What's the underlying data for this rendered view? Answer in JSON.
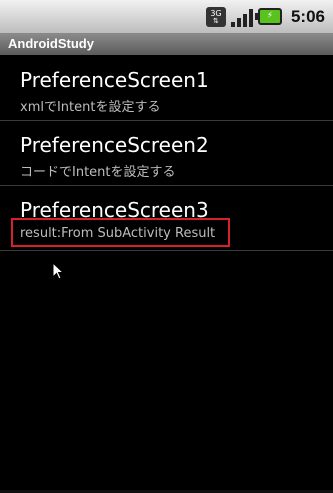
{
  "status_bar": {
    "network_type": "3G",
    "time": "5:06",
    "icons": [
      "3g-data-icon",
      "signal-strength-icon",
      "battery-charging-icon"
    ]
  },
  "app_title": "AndroidStudy",
  "preferences": [
    {
      "title": "PreferenceScreen1",
      "summary": "xmlでIntentを設定する"
    },
    {
      "title": "PreferenceScreen2",
      "summary": "コードでIntentを設定する"
    },
    {
      "title": "PreferenceScreen3",
      "summary": "result:From SubActivity Result"
    }
  ],
  "colors": {
    "background": "#000000",
    "highlight": "#d8202a",
    "summary_text": "#bdbdbd",
    "battery": "#59c21f"
  }
}
